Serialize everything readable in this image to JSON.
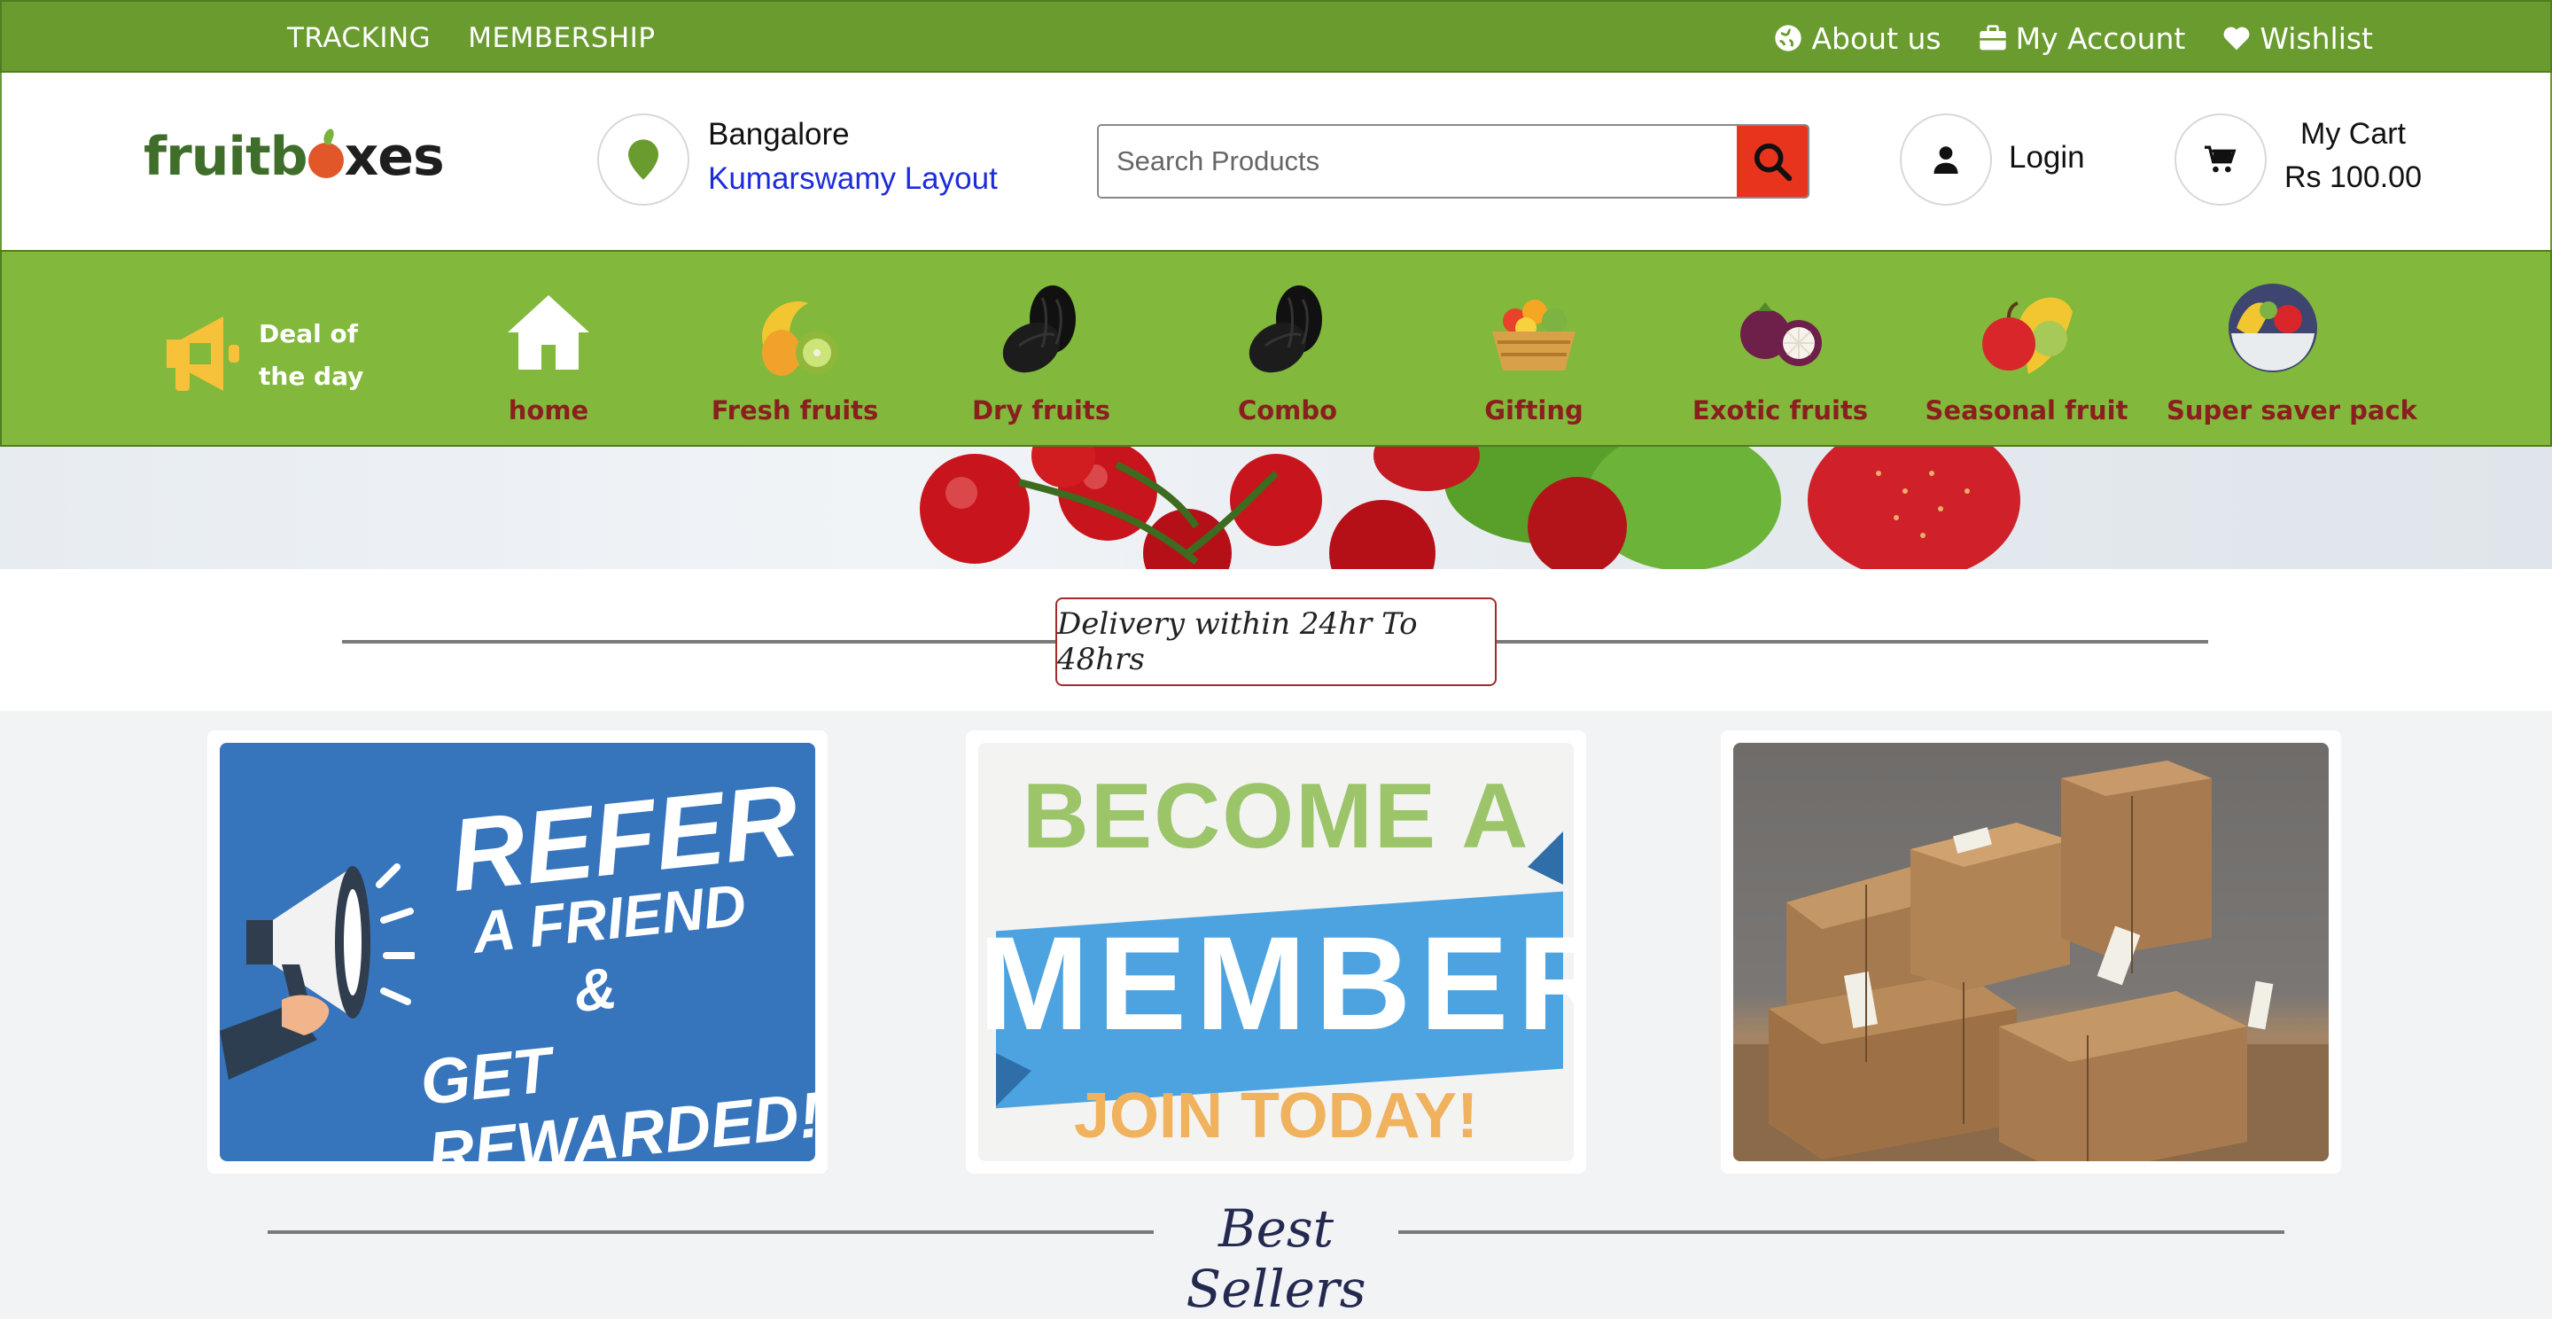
{
  "topbar": {
    "left_links": [
      "TRACKING",
      "MEMBERSHIP"
    ],
    "about": "About us",
    "account": "My Account",
    "wishlist": "Wishlist"
  },
  "header": {
    "logo_parts": [
      "fruitb",
      "xes"
    ],
    "location": {
      "city": "Bangalore",
      "area": "Kumarswamy Layout"
    },
    "search": {
      "placeholder": "Search Products"
    },
    "login": "Login",
    "cart": {
      "label": "My Cart",
      "amount": "Rs 100.00"
    }
  },
  "nav": {
    "deal": [
      "Deal of",
      "the day"
    ],
    "categories": [
      {
        "label": "home",
        "icon": "home-icon"
      },
      {
        "label": "Fresh fruits",
        "icon": "fresh-fruits-icon"
      },
      {
        "label": "Dry fruits",
        "icon": "dates-icon"
      },
      {
        "label": "Combo",
        "icon": "dates-icon"
      },
      {
        "label": "Gifting",
        "icon": "fruit-basket-icon"
      },
      {
        "label": "Exotic fruits",
        "icon": "mangosteen-icon"
      },
      {
        "label": "Seasonal fruit",
        "icon": "seasonal-fruit-icon"
      },
      {
        "label": "Super saver pack",
        "icon": "fruit-bowl-icon"
      }
    ]
  },
  "delivery": "Delivery within 24hr To 48hrs",
  "promos": {
    "refer": {
      "line1": "REFER",
      "line2": "A FRIEND",
      "line3": "&",
      "line4": "GET REWARDED!"
    },
    "member": {
      "line1": "BECOME A",
      "line2": "MEMBER",
      "line3": "JOIN TODAY!"
    }
  },
  "best_sellers": "Best Sellers",
  "colors": {
    "topbar": "#6a9b2f",
    "nav": "#82b83b",
    "category_label": "#8b1e1e",
    "search_button": "#e8341c"
  }
}
